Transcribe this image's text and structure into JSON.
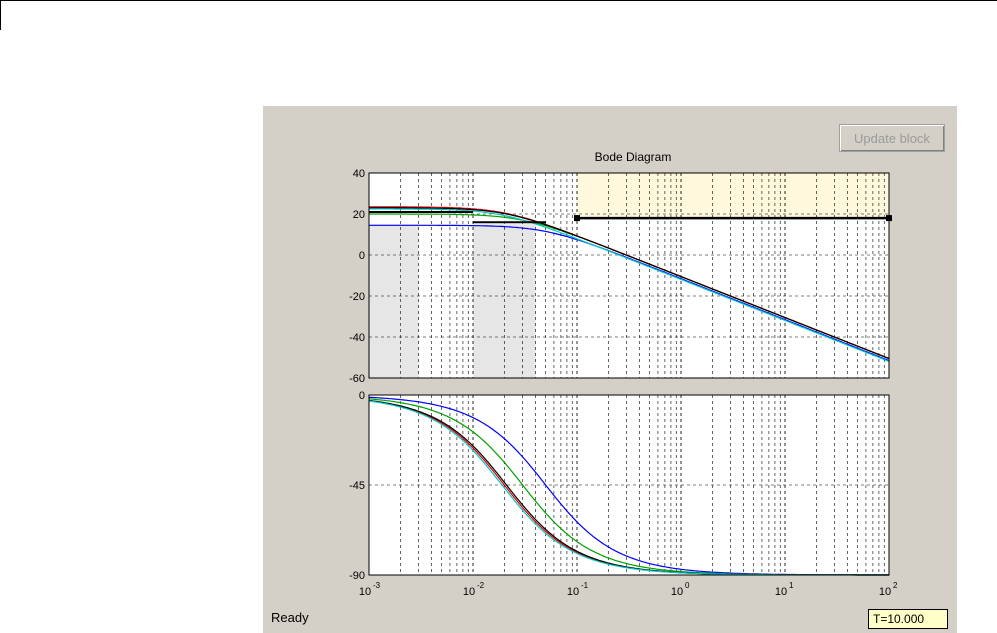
{
  "toolbar": {
    "update_label": "Update block"
  },
  "status": {
    "text": "Ready",
    "time_label": "T=10.000"
  },
  "colors": {
    "window_bg": "#d4d0c8",
    "axes_bg": "#ffffff",
    "shade": "#e6e6e6",
    "highlight": "#fff8dc",
    "time_bg": "#ffffc8"
  },
  "chart_data": [
    {
      "type": "line",
      "title": "Bode Diagram",
      "xscale": "log",
      "xlim": [
        0.001,
        100
      ],
      "ylim": [
        -60,
        40
      ],
      "ytick_labels": [
        "40",
        "20",
        "0",
        "-20",
        "-40",
        "-60"
      ],
      "ytick_values": [
        40,
        20,
        0,
        -20,
        -40,
        -60
      ],
      "shaded_ranges": [
        [
          0.001,
          0.003
        ],
        [
          0.01,
          0.04
        ]
      ],
      "highlight": {
        "x": [
          0.1,
          100
        ],
        "y": [
          18,
          40
        ],
        "line_y": 18
      },
      "mini_bars": [
        {
          "x": [
            0.001,
            0.01
          ],
          "y": 21
        },
        {
          "x": [
            0.01,
            0.05
          ],
          "y": 16
        }
      ],
      "series": [
        {
          "color": "#0000ff",
          "gain": 14.5,
          "corner": 0.05
        },
        {
          "color": "#00a000",
          "gain": 20.0,
          "corner": 0.03
        },
        {
          "color": "#dd0000",
          "gain": 23.5,
          "corner": 0.02
        },
        {
          "color": "#000000",
          "gain": 23.0,
          "corner": 0.021
        },
        {
          "color": "#00c8c8",
          "gain": 22.5,
          "corner": 0.019
        }
      ]
    },
    {
      "type": "line",
      "xscale": "log",
      "xlim": [
        0.001,
        100
      ],
      "ylim": [
        -90,
        0
      ],
      "ytick_labels": [
        "0",
        "-45",
        "-90"
      ],
      "ytick_values": [
        0,
        -45,
        -90
      ],
      "xtick_values": [
        0.001,
        0.01,
        0.1,
        1,
        10,
        100
      ],
      "xtick_bases": [
        "10",
        "10",
        "10",
        "10",
        "10",
        "10"
      ],
      "xtick_exponents": [
        "-3",
        "-2",
        "-1",
        "0",
        "1",
        "2"
      ],
      "series": [
        {
          "color": "#0000ff",
          "corner": 0.05
        },
        {
          "color": "#00a000",
          "corner": 0.03
        },
        {
          "color": "#dd0000",
          "corner": 0.02
        },
        {
          "color": "#000000",
          "corner": 0.021
        },
        {
          "color": "#00c8c8",
          "corner": 0.019
        }
      ]
    }
  ]
}
